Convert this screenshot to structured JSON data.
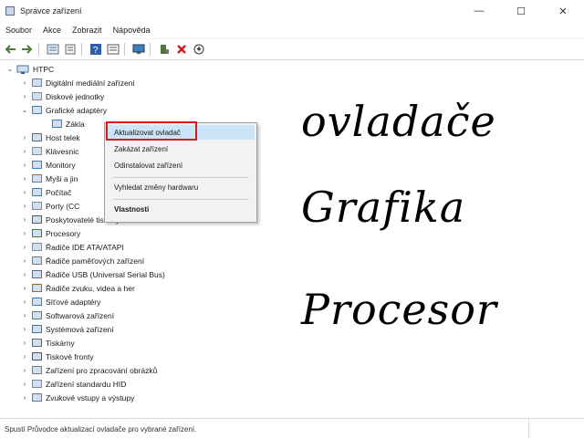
{
  "window": {
    "title": "Správce zařízení",
    "minimize": "—",
    "maximize": "☐",
    "close": "✕"
  },
  "menu": [
    "Soubor",
    "Akce",
    "Zobrazit",
    "Nápověda"
  ],
  "toolbar_icons": [
    "back-arrow-icon",
    "forward-arrow-icon",
    "properties-icon",
    "show-hidden-icon",
    "help-icon",
    "view-icon",
    "monitor-icon",
    "add-driver-icon",
    "uninstall-icon",
    "update-icon"
  ],
  "tree": {
    "root": "HTPC",
    "items": [
      {
        "label": "Digitální mediální zařízení",
        "exp": "›"
      },
      {
        "label": "Diskové jednotky",
        "exp": "›"
      },
      {
        "label": "Grafické adaptéry",
        "exp": "⌄"
      },
      {
        "label": "Zákla",
        "exp": ""
      },
      {
        "label": "Host telek",
        "exp": "›"
      },
      {
        "label": "Klávesnic",
        "exp": "›"
      },
      {
        "label": "Monitory",
        "exp": "›"
      },
      {
        "label": "Myši a jin",
        "exp": "›"
      },
      {
        "label": "Počítač",
        "exp": "›"
      },
      {
        "label": "Porty (CC",
        "exp": "›"
      },
      {
        "label": "Poskytovatelé tiskových služeb WSD",
        "exp": "›"
      },
      {
        "label": "Procesory",
        "exp": "›"
      },
      {
        "label": "Řadiče IDE ATA/ATAPI",
        "exp": "›"
      },
      {
        "label": "Řadiče paměťových zařízení",
        "exp": "›"
      },
      {
        "label": "Řadiče USB (Universal Serial Bus)",
        "exp": "›"
      },
      {
        "label": "Řadiče zvuku, videa a her",
        "exp": "›"
      },
      {
        "label": "Síťové adaptéry",
        "exp": "›"
      },
      {
        "label": "Softwarová zařízení",
        "exp": "›"
      },
      {
        "label": "Systémová zařízení",
        "exp": "›"
      },
      {
        "label": "Tiskárny",
        "exp": "›"
      },
      {
        "label": "Tiskové fronty",
        "exp": "›"
      },
      {
        "label": "Zařízení pro zpracování obrázků",
        "exp": "›"
      },
      {
        "label": "Zařízení standardu HID",
        "exp": "›"
      },
      {
        "label": "Zvukové vstupy a výstupy",
        "exp": "›"
      }
    ]
  },
  "context_menu": {
    "update": "Aktualizovat ovladač",
    "disable": "Zakázat zařízení",
    "uninstall": "Odinstalovat zařízení",
    "scan": "Vyhledat změny hardwaru",
    "properties": "Vlastnosti"
  },
  "handwriting": [
    "ovladače",
    "Grafika",
    "Procesor"
  ],
  "status": "Spustí Průvodce aktualizací ovladače pro vybrané zařízení.",
  "colors": {
    "highlight": "#cce4f7",
    "red_frame": "#d81a1a"
  }
}
